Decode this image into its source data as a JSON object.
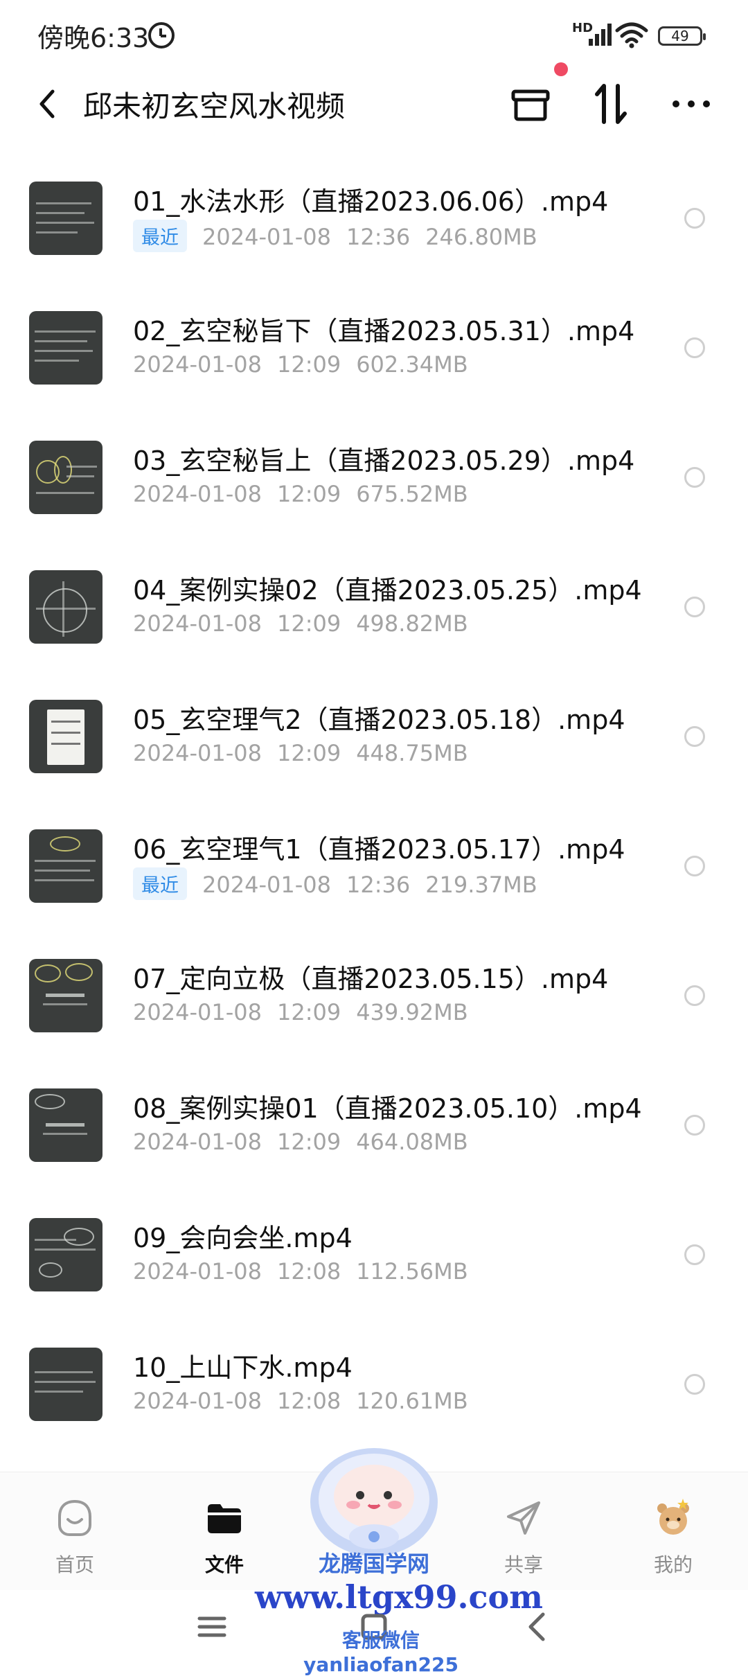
{
  "status_bar": {
    "time": "傍晚6:33",
    "network": "HD",
    "battery": "49"
  },
  "header": {
    "title": "邱未初玄空风水视频"
  },
  "files": [
    {
      "name": "01_水法水形（直播2023.06.06）.mp4",
      "tag": "最近",
      "date": "2024-01-08",
      "time": "12:36",
      "size": "246.80MB"
    },
    {
      "name": "02_玄空秘旨下（直播2023.05.31）.mp4",
      "tag": "",
      "date": "2024-01-08",
      "time": "12:09",
      "size": "602.34MB"
    },
    {
      "name": "03_玄空秘旨上（直播2023.05.29）.mp4",
      "tag": "",
      "date": "2024-01-08",
      "time": "12:09",
      "size": "675.52MB"
    },
    {
      "name": "04_案例实操02（直播2023.05.25）.mp4",
      "tag": "",
      "date": "2024-01-08",
      "time": "12:09",
      "size": "498.82MB"
    },
    {
      "name": "05_玄空理气2（直播2023.05.18）.mp4",
      "tag": "",
      "date": "2024-01-08",
      "time": "12:09",
      "size": "448.75MB"
    },
    {
      "name": "06_玄空理气1（直播2023.05.17）.mp4",
      "tag": "最近",
      "date": "2024-01-08",
      "time": "12:36",
      "size": "219.37MB"
    },
    {
      "name": "07_定向立极（直播2023.05.15）.mp4",
      "tag": "",
      "date": "2024-01-08",
      "time": "12:09",
      "size": "439.92MB"
    },
    {
      "name": "08_案例实操01（直播2023.05.10）.mp4",
      "tag": "",
      "date": "2024-01-08",
      "time": "12:09",
      "size": "464.08MB"
    },
    {
      "name": "09_会向会坐.mp4",
      "tag": "",
      "date": "2024-01-08",
      "time": "12:08",
      "size": "112.56MB"
    },
    {
      "name": "10_上山下水.mp4",
      "tag": "",
      "date": "2024-01-08",
      "time": "12:08",
      "size": "120.61MB"
    }
  ],
  "bottom_nav": {
    "home": "首页",
    "files": "文件",
    "share": "共享",
    "me": "我的",
    "active": "files"
  },
  "watermark": {
    "name": "龙腾国学网",
    "url": "www.ltgx99.com",
    "contact": "客服微信 yanliaofan225"
  },
  "colors": {
    "accent": "#2f8be6",
    "recent_bg": "#e8f3fd",
    "badge": "#ef4a63",
    "watermark": "#2a45c9"
  },
  "icons": [
    "back-icon",
    "archive-icon",
    "sort-icon",
    "more-icon",
    "home-icon",
    "folder-icon",
    "share-icon",
    "avatar-icon"
  ]
}
